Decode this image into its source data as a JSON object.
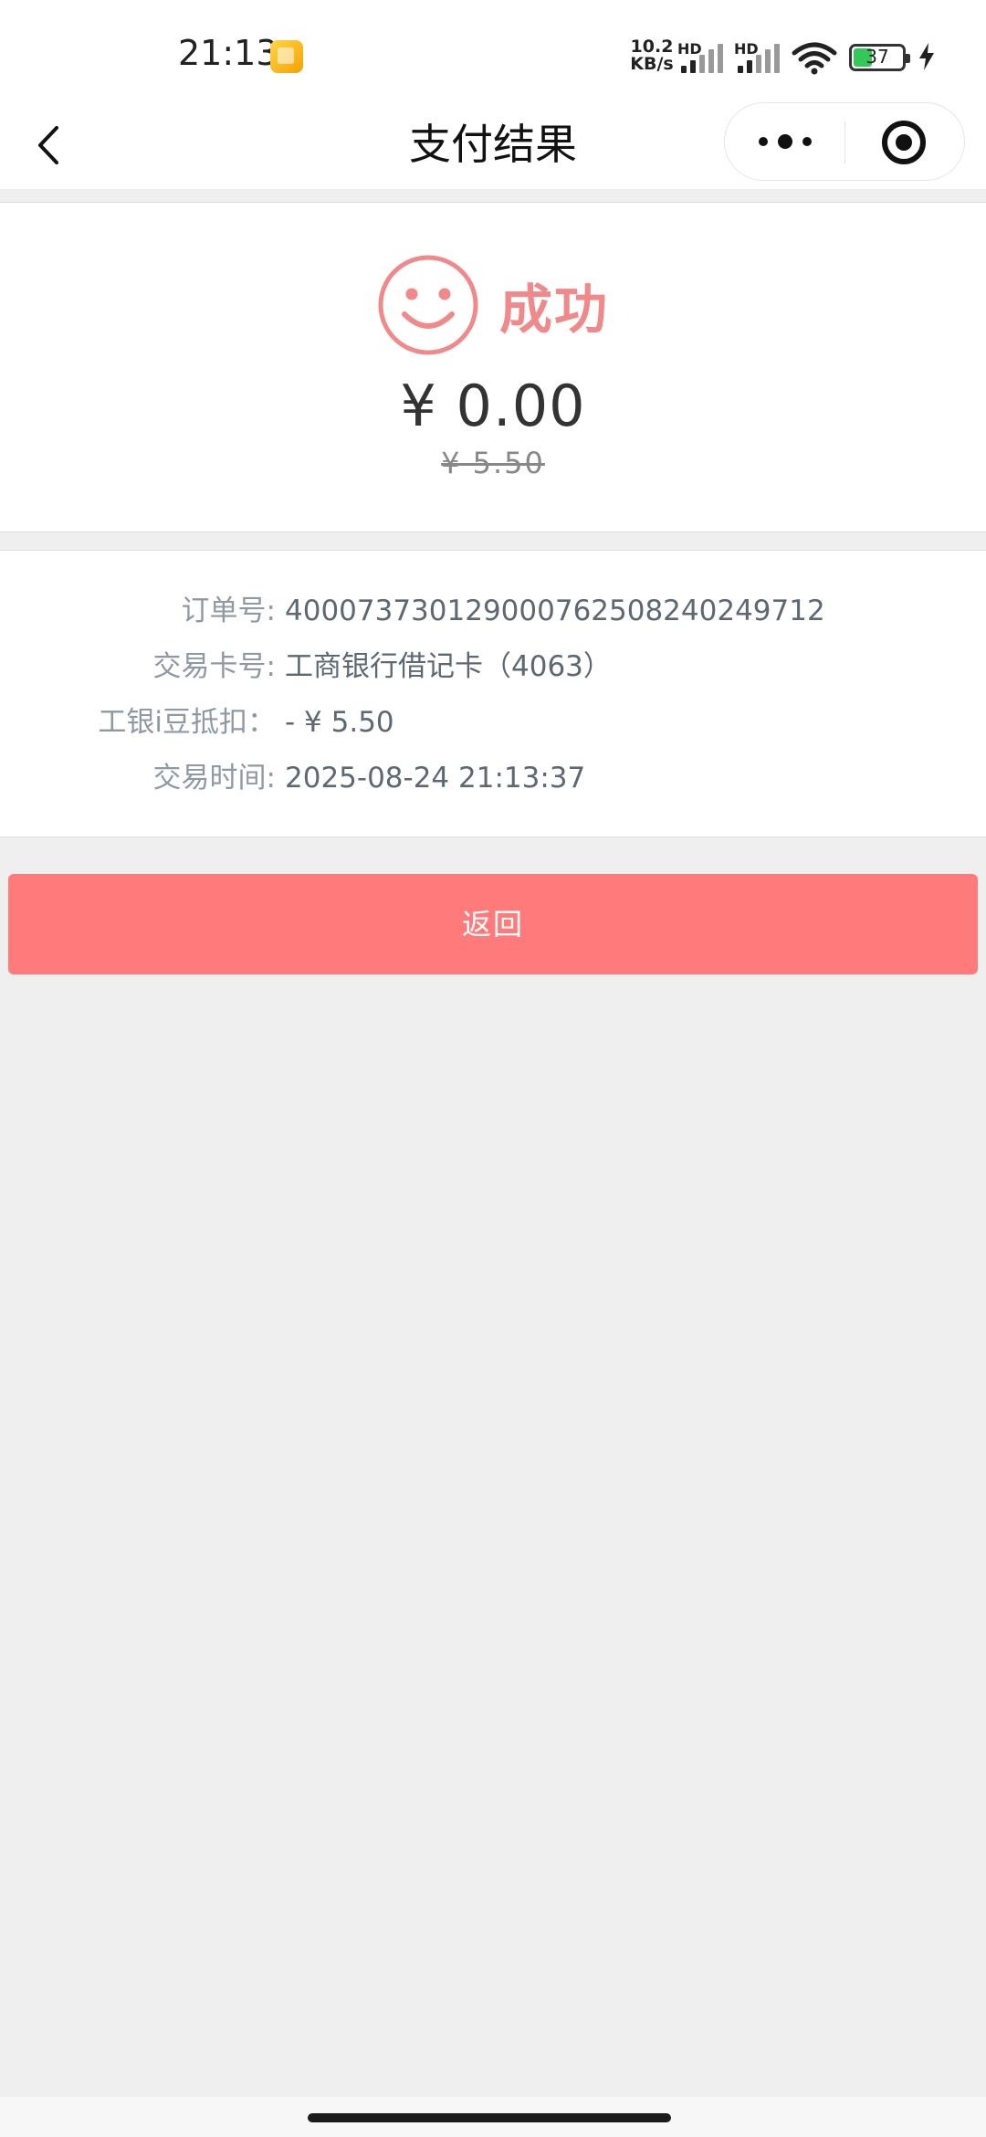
{
  "status_bar": {
    "time": "21:13",
    "net_speed_value": "10.2",
    "net_speed_unit": "KB/s",
    "sim1_label": "HD",
    "sim2_label": "HD",
    "battery_level": "37"
  },
  "nav": {
    "title": "支付结果"
  },
  "result": {
    "status": "成功",
    "amount": "¥ 0.00",
    "original_amount": "¥ 5.50"
  },
  "details": [
    {
      "label": "订单号:",
      "value": "400073730129000762508240249712"
    },
    {
      "label": "交易卡号:",
      "value": "工商银行借记卡（4063）"
    },
    {
      "label": "工银i豆抵扣：",
      "value": "- ¥ 5.50"
    },
    {
      "label": "交易时间:",
      "value": "2025-08-24 21:13:37"
    }
  ],
  "actions": {
    "return_label": "返回"
  },
  "colors": {
    "accent": "#ff7b7b",
    "success_text": "#f08a8a",
    "background": "#efefef"
  }
}
